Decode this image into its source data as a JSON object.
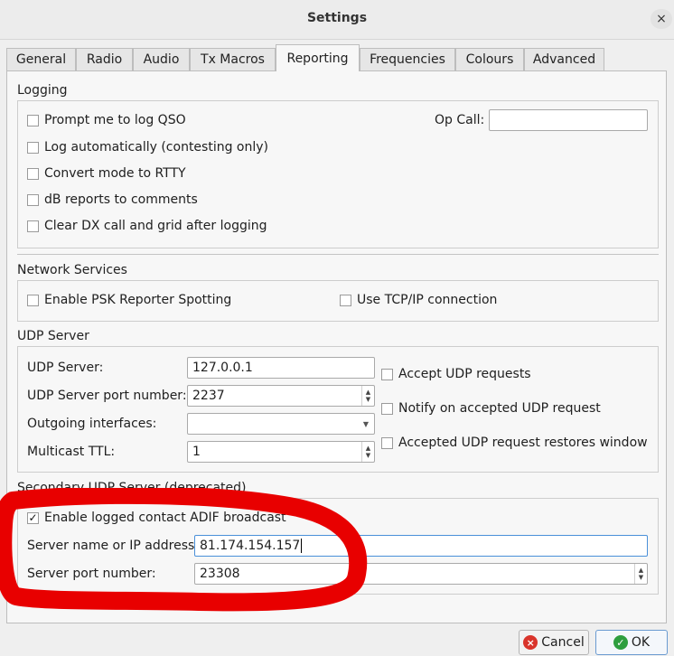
{
  "window": {
    "title": "Settings",
    "close_glyph": "×"
  },
  "tabs": [
    {
      "label": "General",
      "active": false
    },
    {
      "label": "Radio",
      "active": false
    },
    {
      "label": "Audio",
      "active": false
    },
    {
      "label": "Tx Macros",
      "active": false
    },
    {
      "label": "Reporting",
      "active": true
    },
    {
      "label": "Frequencies",
      "active": false
    },
    {
      "label": "Colours",
      "active": false
    },
    {
      "label": "Advanced",
      "active": false
    }
  ],
  "logging": {
    "title": "Logging",
    "options": [
      {
        "label": "Prompt me to log QSO",
        "checked": false
      },
      {
        "label": "Log automatically (contesting only)",
        "checked": false
      },
      {
        "label": "Convert mode to RTTY",
        "checked": false
      },
      {
        "label": "dB reports to comments",
        "checked": false
      },
      {
        "label": "Clear DX call and grid after logging",
        "checked": false
      }
    ],
    "op_call_label": "Op Call:",
    "op_call_value": ""
  },
  "network": {
    "title": "Network Services",
    "psk_label": "Enable PSK Reporter Spotting",
    "psk_checked": false,
    "tcp_label": "Use TCP/IP connection",
    "tcp_checked": false
  },
  "udp": {
    "title": "UDP Server",
    "server_label": "UDP Server:",
    "server_value": "127.0.0.1",
    "port_label": "UDP Server port number:",
    "port_value": "2237",
    "interfaces_label": "Outgoing interfaces:",
    "interfaces_value": "",
    "ttl_label": "Multicast TTL:",
    "ttl_value": "1",
    "accept_label": "Accept UDP requests",
    "accept_checked": false,
    "notify_label": "Notify on accepted UDP request",
    "notify_checked": false,
    "restore_label": "Accepted UDP request restores window",
    "restore_checked": false
  },
  "secondary": {
    "title": "Secondary UDP Server (deprecated)",
    "enable_label": "Enable logged contact ADIF broadcast",
    "enable_checked": true,
    "host_label": "Server name or IP address:",
    "host_value": "81.174.154.157",
    "port_label": "Server port number:",
    "port_value": "23308"
  },
  "buttons": {
    "cancel": "Cancel",
    "ok": "OK"
  },
  "colors": {
    "annotation": "#e80000",
    "cancel_icon": "#d9342b",
    "ok_icon": "#2e9e3e",
    "focus": "#4a90d9"
  },
  "icons": {
    "cancel": "cancel-icon",
    "ok": "check-icon",
    "spin": "spin-arrows-icon",
    "dropdown": "chevron-down-icon"
  }
}
